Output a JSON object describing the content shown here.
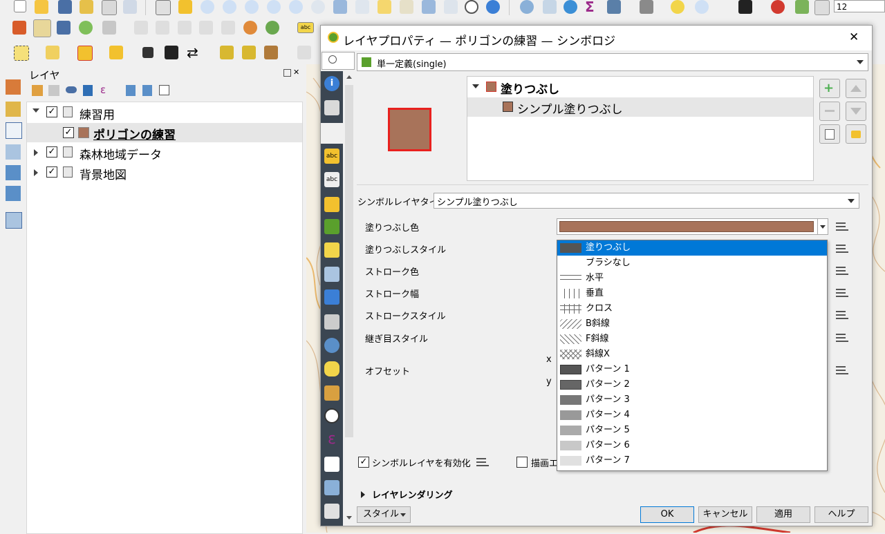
{
  "toolbar": {
    "scale_value": "12"
  },
  "layers_panel": {
    "title": "レイヤ",
    "items": [
      {
        "label": "練習用",
        "checked": true,
        "expanded": true,
        "type": "group"
      },
      {
        "label": "ポリゴンの練習",
        "checked": true,
        "type": "polygon-layer",
        "selected": true
      },
      {
        "label": "森林地域データ",
        "checked": true,
        "expanded": false,
        "type": "group"
      },
      {
        "label": "背景地図",
        "checked": true,
        "expanded": false,
        "type": "group"
      }
    ]
  },
  "dialog": {
    "title": "レイヤプロパティ — ポリゴンの練習 — シンボロジ",
    "renderer": "単一定義(single)",
    "symbol_tree": {
      "root": "塗りつぶし",
      "child": "シンプル塗りつぶし"
    },
    "symbol_layer_type_label": "シンボルレイヤタイプ",
    "symbol_layer_type_value": "シンプル塗りつぶし",
    "fields": {
      "fill_color": "塗りつぶし色",
      "fill_style": "塗りつぶしスタイル",
      "stroke_color": "ストローク色",
      "stroke_width": "ストローク幅",
      "stroke_style": "ストロークスタイル",
      "join_style": "継ぎ目スタイル",
      "offset": "オフセット",
      "offset_x": "x",
      "offset_y": "y"
    },
    "fill_style_options": [
      "塗りつぶし",
      "ブラシなし",
      "水平",
      "垂直",
      "クロス",
      "B斜線",
      "F斜線",
      "斜線X",
      "パターン 1",
      "パターン 2",
      "パターン 3",
      "パターン 4",
      "パターン 5",
      "パターン 6",
      "パターン 7"
    ],
    "selected_fill_style": "塗りつぶし",
    "enable_symbol_layer": "シンボルレイヤを有効化",
    "draw_effects": "描画エ",
    "layer_rendering": "レイヤレンダリング",
    "style_button": "スタイル",
    "buttons": {
      "ok": "OK",
      "cancel": "キャンセル",
      "apply": "適用",
      "help": "ヘルプ"
    },
    "close_symbol": "✕"
  },
  "colors": {
    "fill": "#a8735a",
    "symbol_border": "#e8211e",
    "selection": "#0078d7",
    "sidebar": "#3b4652"
  }
}
